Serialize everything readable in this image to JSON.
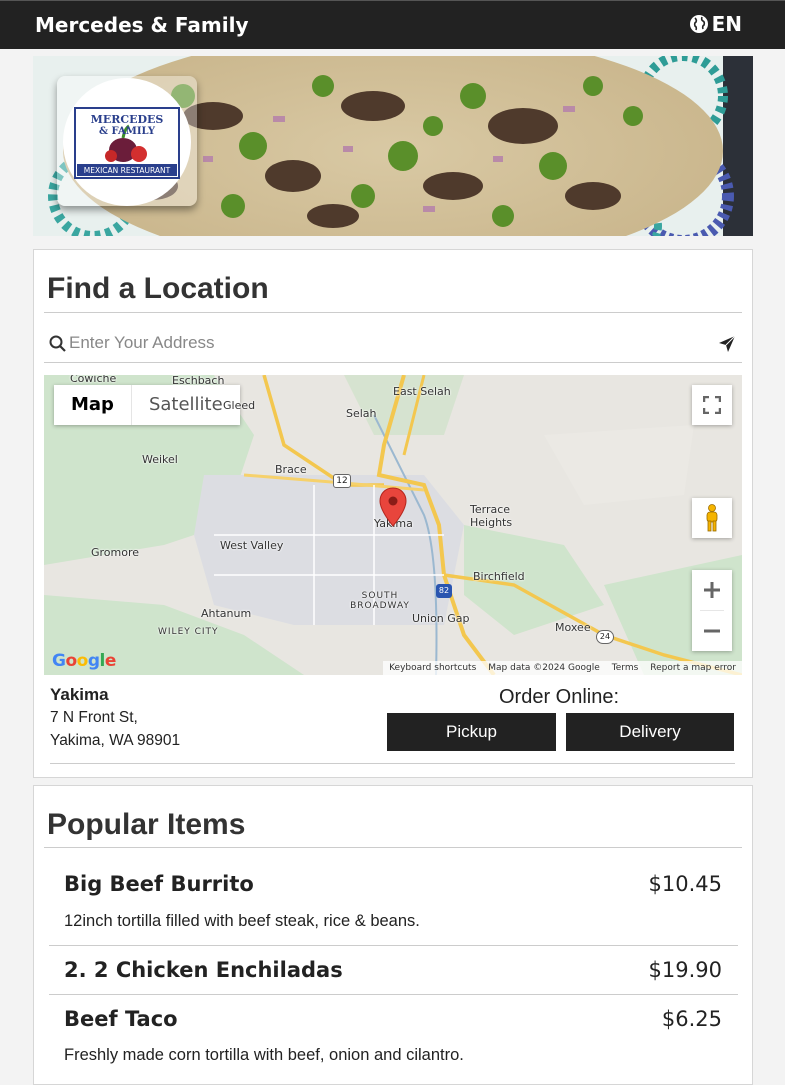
{
  "header": {
    "brand": "Mercedes & Family",
    "language": "EN"
  },
  "hero": {
    "logo_text_line1": "MERCEDES",
    "logo_text_line2": "& FAMILY",
    "logo_text_line3": "MEXICAN RESTAURANT"
  },
  "find_location": {
    "title": "Find a Location",
    "search_placeholder": "Enter Your Address",
    "map": {
      "type_map": "Map",
      "type_satellite": "Satellite",
      "labels": [
        "Cowiche",
        "Eschbach",
        "Gleed",
        "East Selah",
        "Selah",
        "Weikel",
        "Brace",
        "Terrace Heights",
        "Yakima",
        "Gromore",
        "West Valley",
        "Birchfield",
        "SOUTH BROADWAY",
        "Ahtanum",
        "WILEY CITY",
        "Union Gap",
        "Moxee"
      ],
      "shields": [
        "12",
        "82",
        "24"
      ],
      "footer": [
        "Keyboard shortcuts",
        "Map data ©2024 Google",
        "Terms",
        "Report a map error"
      ],
      "logo": "Google"
    },
    "location": {
      "name": "Yakima",
      "street": "7 N Front St,",
      "city": "Yakima, WA 98901"
    },
    "order_title": "Order Online:",
    "pickup_label": "Pickup",
    "delivery_label": "Delivery"
  },
  "popular": {
    "title": "Popular Items",
    "items": [
      {
        "name": "Big Beef Burrito",
        "price": "$10.45",
        "desc": "12inch tortilla filled with beef steak, rice & beans."
      },
      {
        "name": "2. 2 Chicken Enchiladas",
        "price": "$19.90",
        "desc": ""
      },
      {
        "name": "Beef Taco",
        "price": "$6.25",
        "desc": "Freshly made corn tortilla with beef, onion and cilantro."
      }
    ]
  },
  "colors": {
    "dark": "#222222",
    "map_bg": "#e9e7e2",
    "pin": "#e8453c"
  }
}
